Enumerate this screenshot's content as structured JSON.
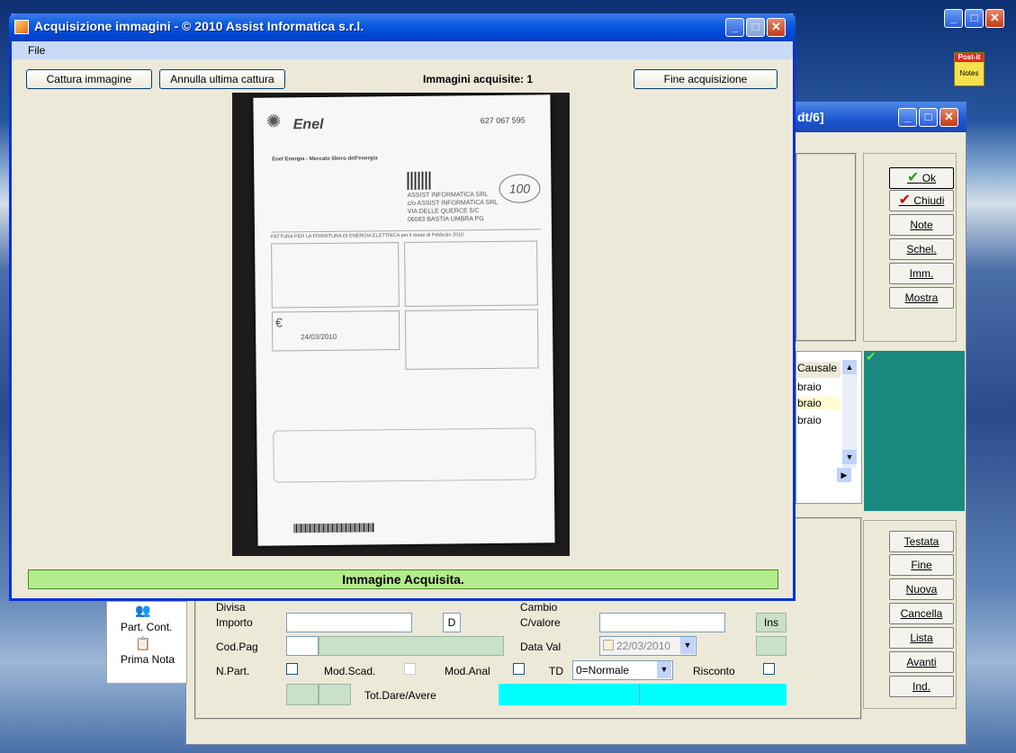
{
  "dialog": {
    "title": "Acquisizione immagini - © 2010 Assist Informatica s.r.l.",
    "menu": [
      "File"
    ],
    "capture_label": "Cattura immagine",
    "undo_label": "Annulla ultima cattura",
    "count_label": "Immagini acquisite: 1",
    "finish_label": "Fine acquisizione",
    "status": "Immagine Acquisita."
  },
  "document": {
    "brand": "Enel",
    "subtitle": "Enel Energia - Mercato libero dell'energia",
    "numbers": [
      "627 067 595",
      "ASSIST INFORMATICA SRL",
      "c/o ASSIST INFORMATICA SRL",
      "VIA DELLE QUERCE 5/C",
      "06083 BASTIA UMBRA PG"
    ],
    "invoice_title": "FATTURA PER LA FORNITURA DI ENERGIA ELETTRICA per il mese di Febbraio 2010",
    "date": "24/03/2010",
    "handwritten": "100"
  },
  "bgwindow": {
    "title_fragment": "dt/6]",
    "right_buttons_top": [
      "Ok",
      "Chiudi",
      "Note",
      "Schel.",
      "Imm.",
      "Mostra"
    ],
    "right_buttons_bottom": [
      "Testata",
      "Fine",
      "Nuova",
      "Cancella",
      "Lista",
      "Avanti",
      "Ind."
    ],
    "grid_header": "Causale",
    "grid_rows": [
      "braio",
      "braio",
      "braio"
    ],
    "form": {
      "divisa_label": "Divisa",
      "cambio_label": "Cambio",
      "importo_label": "Importo",
      "d_value": "D",
      "cvalore_label": "C/valore",
      "ins_label": "Ins",
      "codpag_label": "Cod.Pag",
      "dataval_label": "Data Val",
      "dataval_value": "22/03/2010",
      "npart_label": "N.Part.",
      "modscad_label": "Mod.Scad.",
      "modanal_label": "Mod.Anal",
      "td_label": "TD",
      "td_value": "0=Normale",
      "risconto_label": "Risconto",
      "tot_label": "Tot.Dare/Avere"
    },
    "left_panel": [
      "Part. Cont.",
      "Prima Nota"
    ]
  },
  "desktop": {
    "postit_label_1": "Post-it",
    "postit_label_2": "Notes"
  },
  "colors": {
    "title_blue": "#0046d5",
    "status_green": "#b4eb8c",
    "teal_panel": "#1a8a80",
    "cyan_total": "#00ffff"
  }
}
